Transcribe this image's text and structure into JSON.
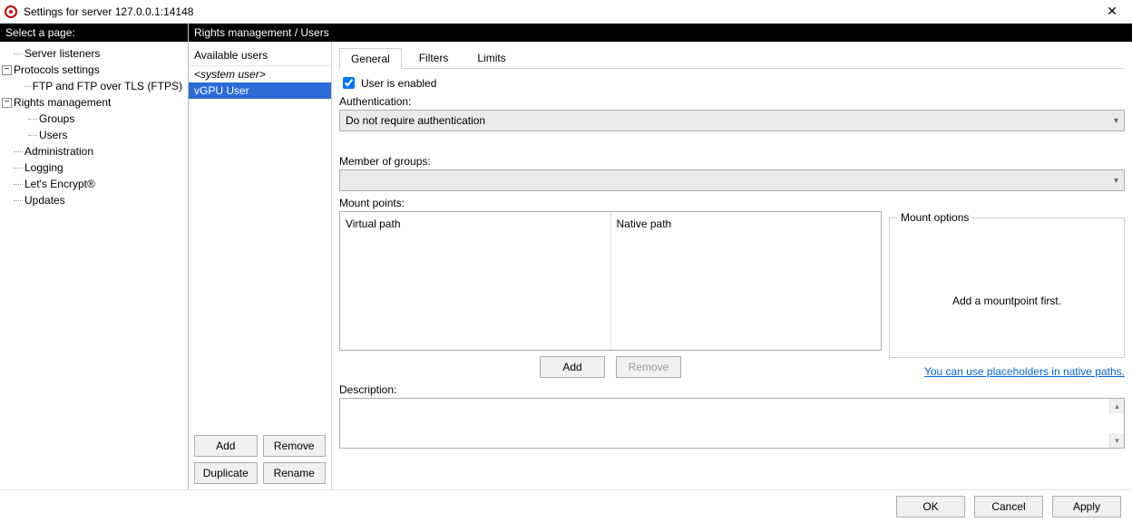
{
  "title": "Settings for server 127.0.0.1:14148",
  "nav_header": "Select a page:",
  "content_header": "Rights management / Users",
  "tree": {
    "server_listeners": "Server listeners",
    "protocols_settings": "Protocols settings",
    "ftps": "FTP and FTP over TLS (FTPS)",
    "rights_management": "Rights management",
    "groups": "Groups",
    "users": "Users",
    "administration": "Administration",
    "logging": "Logging",
    "lets_encrypt": "Let's Encrypt®",
    "updates": "Updates"
  },
  "user_panel": {
    "heading": "Available users",
    "items": [
      {
        "label": "<system user>",
        "italic": true,
        "selected": false
      },
      {
        "label": "vGPU User",
        "italic": false,
        "selected": true
      }
    ],
    "add": "Add",
    "remove": "Remove",
    "duplicate": "Duplicate",
    "rename": "Rename"
  },
  "tabs": {
    "general": "General",
    "filters": "Filters",
    "limits": "Limits"
  },
  "form": {
    "enabled_label": "User is enabled",
    "enabled_checked": true,
    "authentication_label": "Authentication:",
    "authentication_value": "Do not require authentication",
    "member_label": "Member of groups:",
    "member_value": "",
    "mount_label": "Mount points:",
    "virtual_path": "Virtual path",
    "native_path": "Native path",
    "mount_options_label": "Mount options",
    "mount_options_msg": "Add a mountpoint first.",
    "mount_add": "Add",
    "mount_remove": "Remove",
    "placeholders_link": "You can use placeholders in native paths.",
    "description_label": "Description:"
  },
  "footer": {
    "ok": "OK",
    "cancel": "Cancel",
    "apply": "Apply"
  }
}
